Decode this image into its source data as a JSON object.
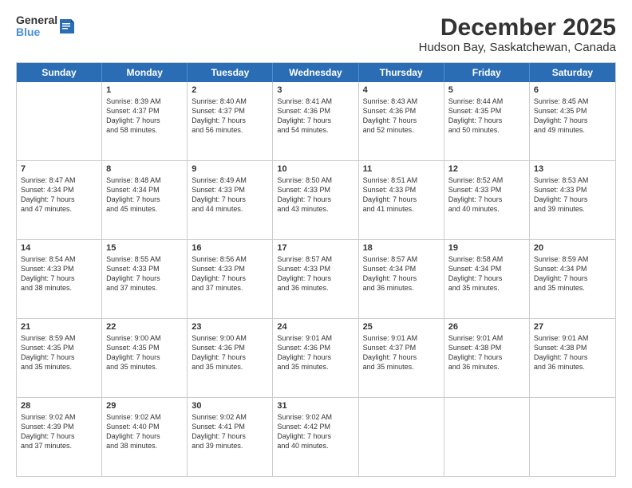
{
  "logo": {
    "line1": "General",
    "line2": "Blue"
  },
  "title": "December 2025",
  "subtitle": "Hudson Bay, Saskatchewan, Canada",
  "header_days": [
    "Sunday",
    "Monday",
    "Tuesday",
    "Wednesday",
    "Thursday",
    "Friday",
    "Saturday"
  ],
  "rows": [
    [
      {
        "day": "",
        "info": ""
      },
      {
        "day": "1",
        "info": "Sunrise: 8:39 AM\nSunset: 4:37 PM\nDaylight: 7 hours\nand 58 minutes."
      },
      {
        "day": "2",
        "info": "Sunrise: 8:40 AM\nSunset: 4:37 PM\nDaylight: 7 hours\nand 56 minutes."
      },
      {
        "day": "3",
        "info": "Sunrise: 8:41 AM\nSunset: 4:36 PM\nDaylight: 7 hours\nand 54 minutes."
      },
      {
        "day": "4",
        "info": "Sunrise: 8:43 AM\nSunset: 4:36 PM\nDaylight: 7 hours\nand 52 minutes."
      },
      {
        "day": "5",
        "info": "Sunrise: 8:44 AM\nSunset: 4:35 PM\nDaylight: 7 hours\nand 50 minutes."
      },
      {
        "day": "6",
        "info": "Sunrise: 8:45 AM\nSunset: 4:35 PM\nDaylight: 7 hours\nand 49 minutes."
      }
    ],
    [
      {
        "day": "7",
        "info": "Sunrise: 8:47 AM\nSunset: 4:34 PM\nDaylight: 7 hours\nand 47 minutes."
      },
      {
        "day": "8",
        "info": "Sunrise: 8:48 AM\nSunset: 4:34 PM\nDaylight: 7 hours\nand 45 minutes."
      },
      {
        "day": "9",
        "info": "Sunrise: 8:49 AM\nSunset: 4:33 PM\nDaylight: 7 hours\nand 44 minutes."
      },
      {
        "day": "10",
        "info": "Sunrise: 8:50 AM\nSunset: 4:33 PM\nDaylight: 7 hours\nand 43 minutes."
      },
      {
        "day": "11",
        "info": "Sunrise: 8:51 AM\nSunset: 4:33 PM\nDaylight: 7 hours\nand 41 minutes."
      },
      {
        "day": "12",
        "info": "Sunrise: 8:52 AM\nSunset: 4:33 PM\nDaylight: 7 hours\nand 40 minutes."
      },
      {
        "day": "13",
        "info": "Sunrise: 8:53 AM\nSunset: 4:33 PM\nDaylight: 7 hours\nand 39 minutes."
      }
    ],
    [
      {
        "day": "14",
        "info": "Sunrise: 8:54 AM\nSunset: 4:33 PM\nDaylight: 7 hours\nand 38 minutes."
      },
      {
        "day": "15",
        "info": "Sunrise: 8:55 AM\nSunset: 4:33 PM\nDaylight: 7 hours\nand 37 minutes."
      },
      {
        "day": "16",
        "info": "Sunrise: 8:56 AM\nSunset: 4:33 PM\nDaylight: 7 hours\nand 37 minutes."
      },
      {
        "day": "17",
        "info": "Sunrise: 8:57 AM\nSunset: 4:33 PM\nDaylight: 7 hours\nand 36 minutes."
      },
      {
        "day": "18",
        "info": "Sunrise: 8:57 AM\nSunset: 4:34 PM\nDaylight: 7 hours\nand 36 minutes."
      },
      {
        "day": "19",
        "info": "Sunrise: 8:58 AM\nSunset: 4:34 PM\nDaylight: 7 hours\nand 35 minutes."
      },
      {
        "day": "20",
        "info": "Sunrise: 8:59 AM\nSunset: 4:34 PM\nDaylight: 7 hours\nand 35 minutes."
      }
    ],
    [
      {
        "day": "21",
        "info": "Sunrise: 8:59 AM\nSunset: 4:35 PM\nDaylight: 7 hours\nand 35 minutes."
      },
      {
        "day": "22",
        "info": "Sunrise: 9:00 AM\nSunset: 4:35 PM\nDaylight: 7 hours\nand 35 minutes."
      },
      {
        "day": "23",
        "info": "Sunrise: 9:00 AM\nSunset: 4:36 PM\nDaylight: 7 hours\nand 35 minutes."
      },
      {
        "day": "24",
        "info": "Sunrise: 9:01 AM\nSunset: 4:36 PM\nDaylight: 7 hours\nand 35 minutes."
      },
      {
        "day": "25",
        "info": "Sunrise: 9:01 AM\nSunset: 4:37 PM\nDaylight: 7 hours\nand 35 minutes."
      },
      {
        "day": "26",
        "info": "Sunrise: 9:01 AM\nSunset: 4:38 PM\nDaylight: 7 hours\nand 36 minutes."
      },
      {
        "day": "27",
        "info": "Sunrise: 9:01 AM\nSunset: 4:38 PM\nDaylight: 7 hours\nand 36 minutes."
      }
    ],
    [
      {
        "day": "28",
        "info": "Sunrise: 9:02 AM\nSunset: 4:39 PM\nDaylight: 7 hours\nand 37 minutes."
      },
      {
        "day": "29",
        "info": "Sunrise: 9:02 AM\nSunset: 4:40 PM\nDaylight: 7 hours\nand 38 minutes."
      },
      {
        "day": "30",
        "info": "Sunrise: 9:02 AM\nSunset: 4:41 PM\nDaylight: 7 hours\nand 39 minutes."
      },
      {
        "day": "31",
        "info": "Sunrise: 9:02 AM\nSunset: 4:42 PM\nDaylight: 7 hours\nand 40 minutes."
      },
      {
        "day": "",
        "info": ""
      },
      {
        "day": "",
        "info": ""
      },
      {
        "day": "",
        "info": ""
      }
    ]
  ]
}
